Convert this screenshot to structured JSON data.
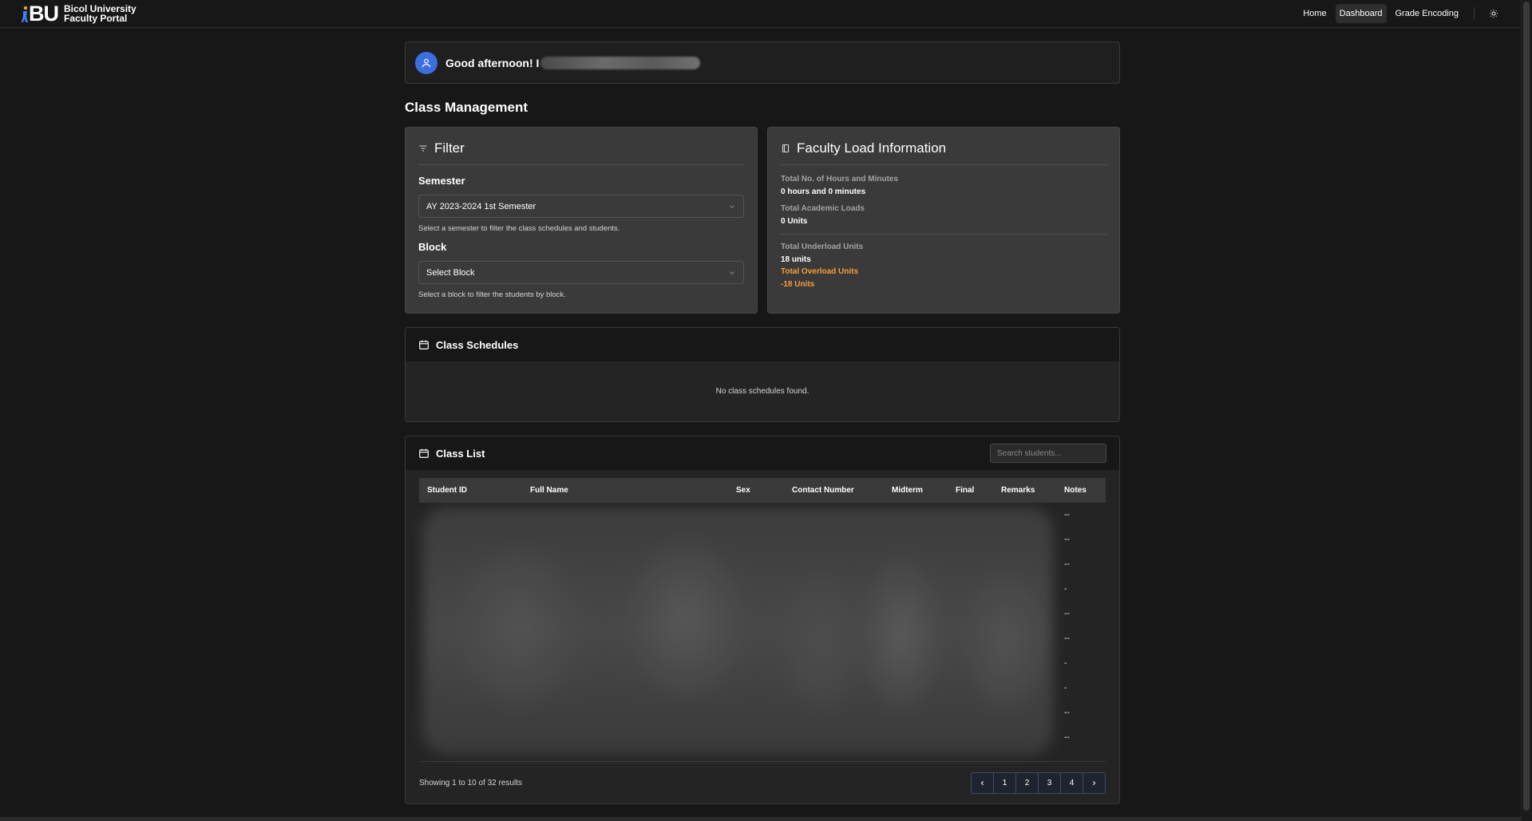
{
  "header": {
    "brand_short": "BU",
    "brand_line1": "Bicol University",
    "brand_line2": "Faculty Portal",
    "nav": [
      {
        "label": "Home",
        "active": false
      },
      {
        "label": "Dashboard",
        "active": true
      },
      {
        "label": "Grade Encoding",
        "active": false
      }
    ],
    "theme_icon": "sun-icon"
  },
  "greeting": {
    "text": "Good afternoon! I"
  },
  "main": {
    "section_title": "Class Management"
  },
  "filter": {
    "title": "Filter",
    "semester_label": "Semester",
    "semester_value": "AY 2023-2024 1st Semester",
    "semester_hint": "Select a semester to filter the class schedules and students.",
    "block_label": "Block",
    "block_value": "Select Block",
    "block_hint": "Select a block to filter the students by block."
  },
  "faculty_load": {
    "title": "Faculty Load Information",
    "hours_label": "Total No. of Hours and Minutes",
    "hours_value": "0 hours and 0 minutes",
    "academic_label": "Total Academic Loads",
    "academic_value": "0 Units",
    "underload_label": "Total Underload Units",
    "underload_value": "18 units",
    "overload_label": "Total Overload Units",
    "overload_value": "-18 Units",
    "accent_color": "#f59e3b"
  },
  "schedules": {
    "title": "Class Schedules",
    "empty": "No class schedules found."
  },
  "class_list": {
    "title": "Class List",
    "search_placeholder": "Search students...",
    "columns": [
      "Student ID",
      "Full Name",
      "Sex",
      "Contact Number",
      "Midterm",
      "Final",
      "Remarks",
      "Notes"
    ],
    "rows_notes": [
      "--",
      "--",
      "--",
      "-",
      "--",
      "--",
      "-",
      "-",
      "--",
      "--"
    ],
    "showing": "Showing 1 to 10 of 32 results",
    "pages": [
      "1",
      "2",
      "3",
      "4"
    ],
    "prev_icon": "chevron-left-icon",
    "next_icon": "chevron-right-icon"
  }
}
